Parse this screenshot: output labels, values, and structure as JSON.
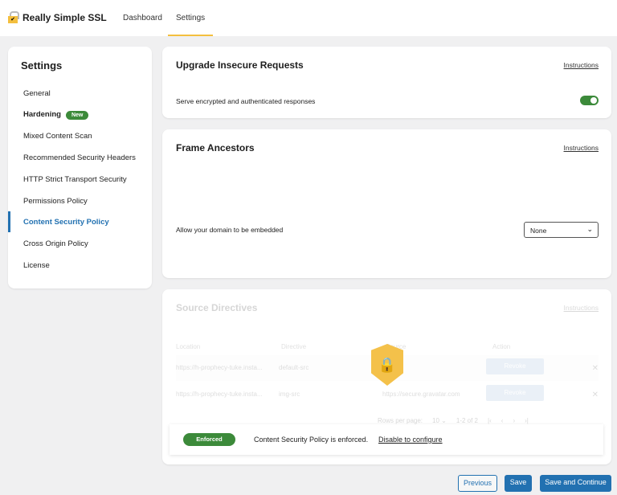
{
  "header": {
    "brand": "Really Simple SSL",
    "nav": [
      "Dashboard",
      "Settings"
    ],
    "active": "Settings"
  },
  "sidebar": {
    "title": "Settings",
    "items": [
      {
        "label": "General"
      },
      {
        "label": "Hardening",
        "badge": "New"
      },
      {
        "label": "Mixed Content Scan"
      },
      {
        "label": "Recommended Security Headers"
      },
      {
        "label": "HTTP Strict Transport Security"
      },
      {
        "label": "Permissions Policy"
      },
      {
        "label": "Content Security Policy",
        "active": true
      },
      {
        "label": "Cross Origin Policy"
      },
      {
        "label": "License"
      }
    ]
  },
  "upgrade": {
    "title": "Upgrade Insecure Requests",
    "instructions": "Instructions",
    "setting": "Serve encrypted and authenticated responses",
    "enabled": true
  },
  "frame": {
    "title": "Frame Ancestors",
    "instructions": "Instructions",
    "setting": "Allow your domain to be embedded",
    "value": "None"
  },
  "source": {
    "title": "Source Directives",
    "instructions": "Instructions",
    "columns": [
      "Location",
      "Directive",
      "Source",
      "Action"
    ],
    "rows": [
      {
        "location": "https://h-prophecy-tuke.insta...",
        "directive": "default-src",
        "source": "",
        "action": "Revoke"
      },
      {
        "location": "https://h-prophecy-tuke.insta...",
        "directive": "img-src",
        "source": "https://secure.gravatar.com",
        "action": "Revoke"
      }
    ],
    "pagination": {
      "rows_label": "Rows per page:",
      "rows": "10",
      "range": "1-2 of 2"
    }
  },
  "notice": {
    "badge": "Enforced",
    "text": "Content Security Policy is enforced.",
    "link": "Disable to configure"
  },
  "footer": {
    "previous": "Previous",
    "save": "Save",
    "save_continue": "Save and Continue"
  },
  "colors": {
    "accent": "#f4bf3e",
    "green": "#3c8a3a",
    "blue": "#2271b1"
  }
}
